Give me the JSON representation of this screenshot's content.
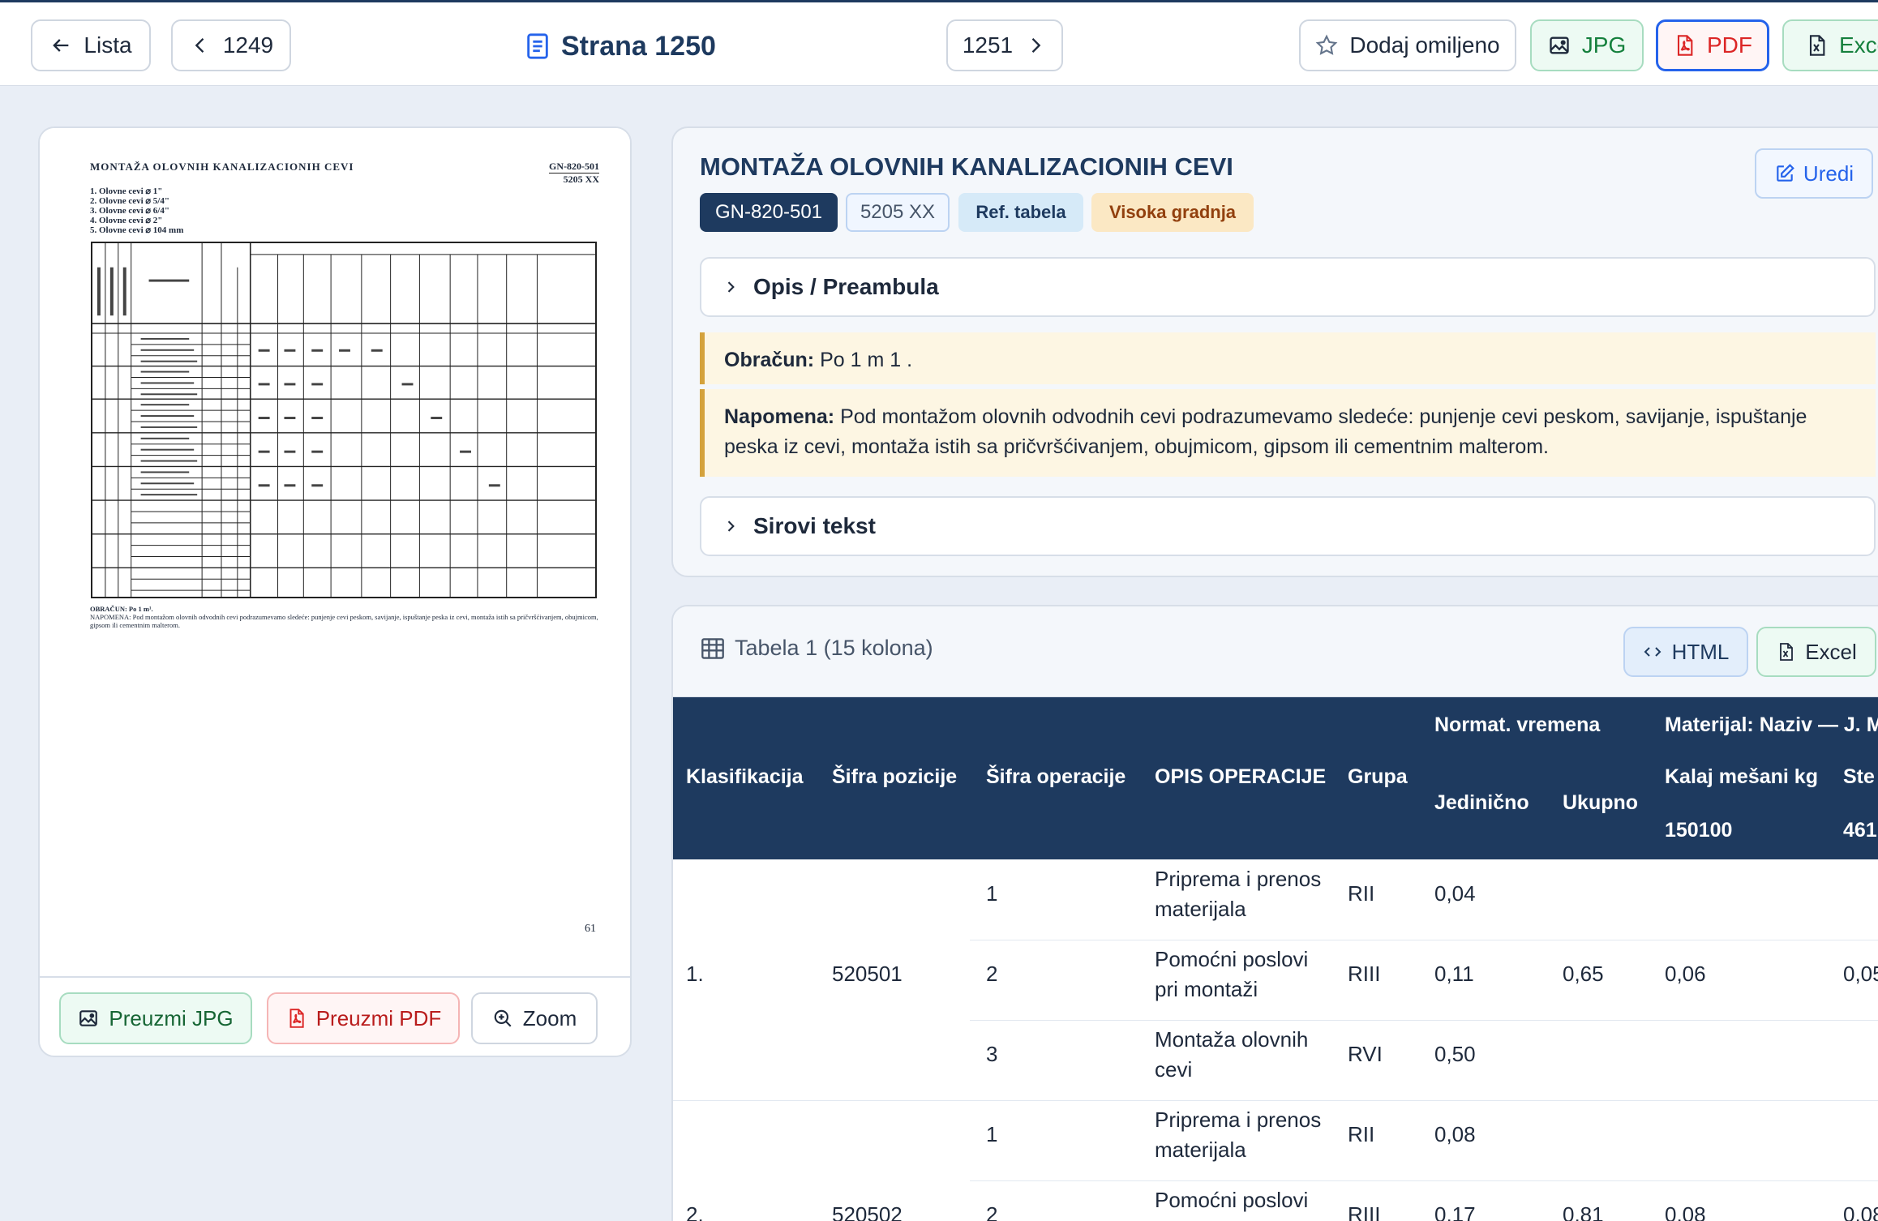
{
  "toolbar": {
    "back_label": "Lista",
    "prev_label": "1249",
    "page_title": "Strana 1250",
    "next_label": "1251",
    "favorite_label": "Dodaj omiljeno",
    "jpg_label": "JPG",
    "pdf_label": "PDF",
    "excel_label": "Exce"
  },
  "preview": {
    "scan": {
      "title": "MONTAŽA OLOVNIH KANALIZACIONIH CEVI",
      "code1": "GN-820-501",
      "code2": "5205 XX",
      "list": [
        "1. Olovne cevi ⌀ 1\"",
        "2. Olovne cevi ⌀ 5/4\"",
        "3. Olovne cevi ⌀ 6/4\"",
        "4. Olovne cevi ⌀ 2\"",
        "5. Olovne cevi ⌀ 104 mm"
      ],
      "foot1": "OBRAČUN: Po 1 m¹.",
      "foot2": "NAPOMENA: Pod montažom olovnih odvodnih cevi podrazumevamo sledeće: punjenje cevi peskom, savijanje, ispuštanje peska iz cevi, montaža istih sa pričvršćivanjem, obujmicom, gipsom ili cementnim malterom.",
      "page_number": "61"
    },
    "download_jpg": "Preuzmi JPG",
    "download_pdf": "Preuzmi PDF",
    "zoom": "Zoom"
  },
  "info": {
    "title": "MONTAŽA OLOVNIH KANALIZACIONIH CEVI",
    "edit_label": "Uredi",
    "tags": [
      "GN-820-501",
      "5205 XX",
      "Ref. tabela",
      "Visoka gradnja"
    ],
    "preamble_label": "Opis / Preambula",
    "calc_label": "Obračun:",
    "calc_text": "Po 1 m 1 .",
    "note_label": "Napomena:",
    "note_text": "Pod montažom olovnih odvodnih cevi podrazumevamo sledeće: punjenje cevi peskom, savijanje, ispuštanje peska iz cevi, montaža istih sa pričvršćivanjem, obujmicom, gipsom ili cementnim malterom.",
    "raw_label": "Sirovi tekst"
  },
  "table": {
    "title": "Tabela 1 (15 kolona)",
    "html_label": "HTML",
    "excel_label": "Excel",
    "group_normat": "Normat. vremena",
    "group_material": "Materijal: Naziv — J. M",
    "columns": [
      "Klasifikacija",
      "Šifra pozicije",
      "Šifra operacije",
      "OPIS OPERACIJE",
      "Grupa",
      "Jedinično",
      "Ukupno",
      "Kalaj mešani kg",
      "Ste"
    ],
    "material_codes": [
      "150100",
      "461"
    ],
    "rows": [
      {
        "klas": "",
        "sifra_poz": "",
        "sifra_op": "1",
        "opis": [
          "Priprema i prenos",
          "materijala"
        ],
        "grupa": "RII",
        "jed": "0,04",
        "uk": "",
        "kalaj": "",
        "ste": ""
      },
      {
        "klas": "1.",
        "sifra_poz": "520501",
        "sifra_op": "2",
        "opis": [
          "Pomoćni poslovi",
          "pri montaži"
        ],
        "grupa": "RIII",
        "jed": "0,11",
        "uk": "0,65",
        "kalaj": "0,06",
        "ste": "0,05"
      },
      {
        "klas": "",
        "sifra_poz": "",
        "sifra_op": "3",
        "opis": [
          "Montaža olovnih",
          "cevi"
        ],
        "grupa": "RVI",
        "jed": "0,50",
        "uk": "",
        "kalaj": "",
        "ste": ""
      },
      {
        "klas": "",
        "sifra_poz": "",
        "sifra_op": "1",
        "opis": [
          "Priprema i prenos",
          "materijala"
        ],
        "grupa": "RII",
        "jed": "0,08",
        "uk": "",
        "kalaj": "",
        "ste": ""
      },
      {
        "klas": "2.",
        "sifra_poz": "520502",
        "sifra_op": "2",
        "opis": [
          "Pomoćni poslovi",
          ""
        ],
        "grupa": "RIII",
        "jed": "0,17",
        "uk": "0,81",
        "kalaj": "0,08",
        "ste": "0,08"
      }
    ]
  }
}
